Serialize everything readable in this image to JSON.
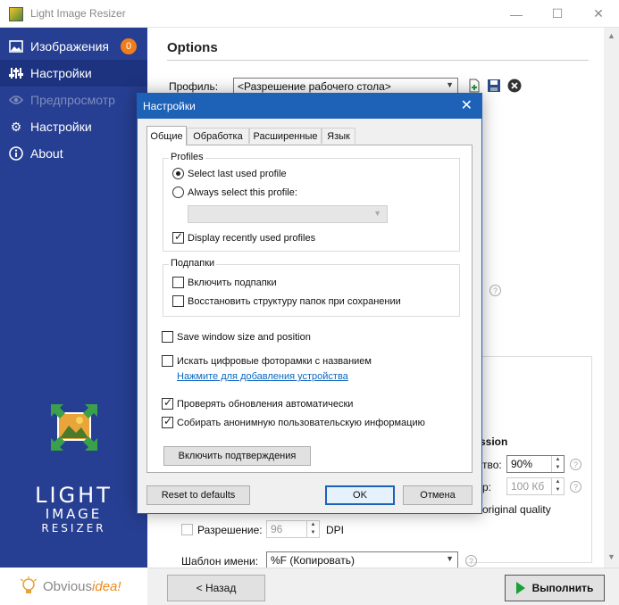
{
  "window": {
    "title": "Light Image Resizer",
    "minimize": "—",
    "maximize": "☐",
    "close": "✕"
  },
  "sidebar": {
    "items": [
      {
        "label": "Изображения",
        "icon": "images-icon",
        "badge": "0"
      },
      {
        "label": "Настройки",
        "icon": "sliders-icon"
      },
      {
        "label": "Предпросмотр",
        "icon": "eye-icon"
      },
      {
        "label": "Настройки",
        "icon": "gear-icon"
      },
      {
        "label": "About",
        "icon": "info-icon"
      }
    ],
    "logo": {
      "line1": "LIGHT",
      "line2": "IMAGE",
      "line3": "RESIZER"
    },
    "brand": {
      "name": "Obvious",
      "accent": "idea!"
    }
  },
  "main": {
    "title": "Options",
    "profile_label": "Профиль:",
    "profile_value": "<Разрешение рабочего стола>",
    "compression_label": "ssion",
    "quality_label": "тво:",
    "quality_value": "90%",
    "size_label": "р:",
    "size_value": "100 Кб",
    "original_quality_label": "original quality",
    "resolution_label": "Разрешение:",
    "resolution_value": "96",
    "dpi_label": "DPI",
    "template_label": "Шаблон имени:",
    "template_value": "%F (Копировать)",
    "back_button": "< Назад",
    "run_button": "Выполнить"
  },
  "dialog": {
    "title": "Настройки",
    "tabs": [
      "Общие",
      "Обработка",
      "Расширенные",
      "Язык"
    ],
    "profiles_group": "Profiles",
    "select_last": "Select last used profile",
    "always_select": "Always select this profile:",
    "display_recent": "Display recently used profiles",
    "subfolders_group": "Подпапки",
    "include_subfolders": "Включить подпапки",
    "restore_structure": "Восстановить структуру папок при сохранении",
    "save_window": "Save window size and position",
    "search_frames": "Искать цифровые фоторамки с названием",
    "add_device_link": "Нажмите для добавления устройства",
    "check_updates": "Проверять обновления автоматически",
    "collect_info": "Собирать анонимную пользовательскую информацию",
    "enable_confirm": "Включить подтверждения",
    "reset_defaults": "Reset to defaults",
    "ok": "OK",
    "cancel": "Отмена"
  },
  "colors": {
    "sidebar_bg": "#273f92",
    "dialog_accent": "#1e62b8",
    "badge": "#f07d1c",
    "run_arrow": "#1aa036"
  }
}
